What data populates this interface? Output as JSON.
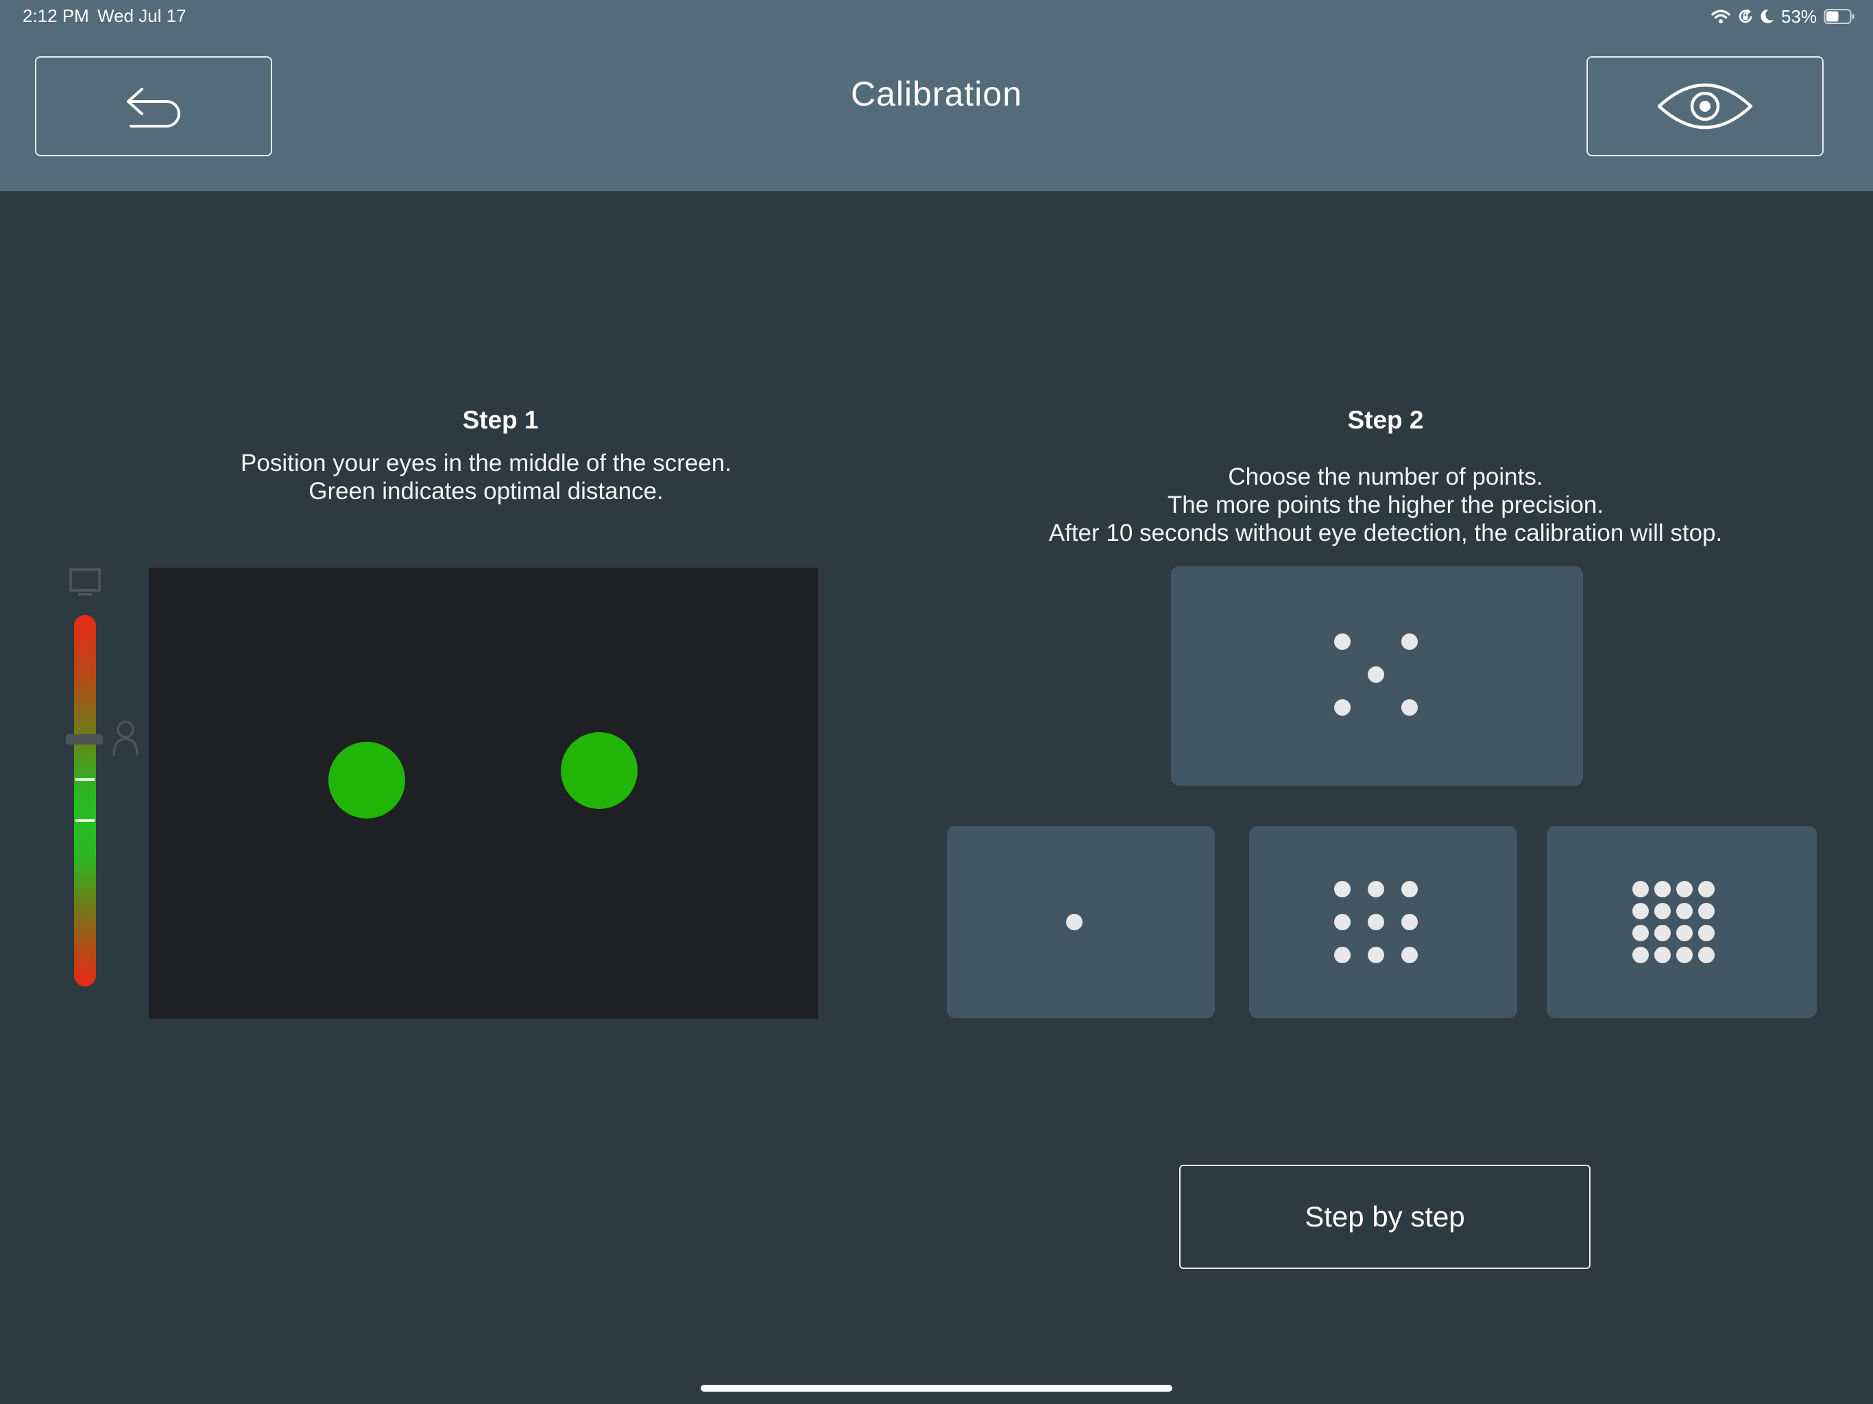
{
  "status_bar": {
    "time": "2:12 PM",
    "date": "Wed Jul 17",
    "battery_percent": "53%",
    "icons": [
      "wifi-icon",
      "orientation-lock-icon",
      "moon-icon",
      "battery-icon"
    ],
    "battery_level": 0.53
  },
  "header": {
    "title": "Calibration",
    "back_icon": "undo-arrow-icon",
    "eye_icon": "eye-icon"
  },
  "step1": {
    "title": "Step 1",
    "description_lines": [
      "Position your eyes in the middle of the screen.",
      "Green indicates optimal distance."
    ],
    "gauge_icons": [
      "monitor-icon",
      "person-icon"
    ]
  },
  "step2": {
    "title": "Step 2",
    "description_lines": [
      "Choose the number of points.",
      "The more points the higher the precision.",
      "After 10 seconds without eye detection, the calibration will stop."
    ],
    "options": [
      {
        "points": 5
      },
      {
        "points": 1
      },
      {
        "points": 9
      },
      {
        "points": 16
      }
    ],
    "step_by_step_label": "Step by step"
  },
  "colors": {
    "header_bg": "#546b7a",
    "page_bg": "#2d3a42",
    "card_bg": "#435663",
    "preview_bg": "#1f2024",
    "eye_green": "#21b507",
    "gauge_red": "#ea2b17",
    "gauge_green": "#25c020"
  }
}
